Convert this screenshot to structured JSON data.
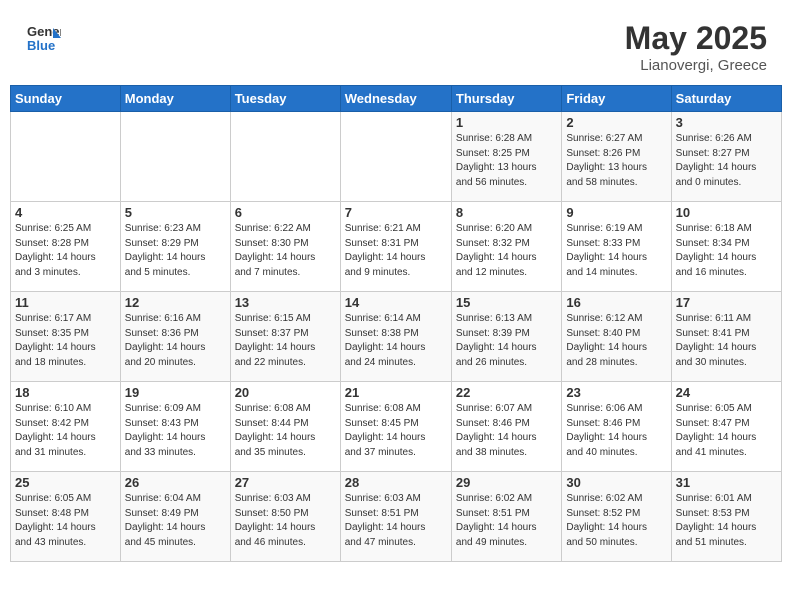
{
  "header": {
    "logo_line1": "General",
    "logo_line2": "Blue",
    "month_year": "May 2025",
    "location": "Lianovergi, Greece"
  },
  "weekdays": [
    "Sunday",
    "Monday",
    "Tuesday",
    "Wednesday",
    "Thursday",
    "Friday",
    "Saturday"
  ],
  "weeks": [
    [
      {
        "day": "",
        "detail": ""
      },
      {
        "day": "",
        "detail": ""
      },
      {
        "day": "",
        "detail": ""
      },
      {
        "day": "",
        "detail": ""
      },
      {
        "day": "1",
        "detail": "Sunrise: 6:28 AM\nSunset: 8:25 PM\nDaylight: 13 hours\nand 56 minutes."
      },
      {
        "day": "2",
        "detail": "Sunrise: 6:27 AM\nSunset: 8:26 PM\nDaylight: 13 hours\nand 58 minutes."
      },
      {
        "day": "3",
        "detail": "Sunrise: 6:26 AM\nSunset: 8:27 PM\nDaylight: 14 hours\nand 0 minutes."
      }
    ],
    [
      {
        "day": "4",
        "detail": "Sunrise: 6:25 AM\nSunset: 8:28 PM\nDaylight: 14 hours\nand 3 minutes."
      },
      {
        "day": "5",
        "detail": "Sunrise: 6:23 AM\nSunset: 8:29 PM\nDaylight: 14 hours\nand 5 minutes."
      },
      {
        "day": "6",
        "detail": "Sunrise: 6:22 AM\nSunset: 8:30 PM\nDaylight: 14 hours\nand 7 minutes."
      },
      {
        "day": "7",
        "detail": "Sunrise: 6:21 AM\nSunset: 8:31 PM\nDaylight: 14 hours\nand 9 minutes."
      },
      {
        "day": "8",
        "detail": "Sunrise: 6:20 AM\nSunset: 8:32 PM\nDaylight: 14 hours\nand 12 minutes."
      },
      {
        "day": "9",
        "detail": "Sunrise: 6:19 AM\nSunset: 8:33 PM\nDaylight: 14 hours\nand 14 minutes."
      },
      {
        "day": "10",
        "detail": "Sunrise: 6:18 AM\nSunset: 8:34 PM\nDaylight: 14 hours\nand 16 minutes."
      }
    ],
    [
      {
        "day": "11",
        "detail": "Sunrise: 6:17 AM\nSunset: 8:35 PM\nDaylight: 14 hours\nand 18 minutes."
      },
      {
        "day": "12",
        "detail": "Sunrise: 6:16 AM\nSunset: 8:36 PM\nDaylight: 14 hours\nand 20 minutes."
      },
      {
        "day": "13",
        "detail": "Sunrise: 6:15 AM\nSunset: 8:37 PM\nDaylight: 14 hours\nand 22 minutes."
      },
      {
        "day": "14",
        "detail": "Sunrise: 6:14 AM\nSunset: 8:38 PM\nDaylight: 14 hours\nand 24 minutes."
      },
      {
        "day": "15",
        "detail": "Sunrise: 6:13 AM\nSunset: 8:39 PM\nDaylight: 14 hours\nand 26 minutes."
      },
      {
        "day": "16",
        "detail": "Sunrise: 6:12 AM\nSunset: 8:40 PM\nDaylight: 14 hours\nand 28 minutes."
      },
      {
        "day": "17",
        "detail": "Sunrise: 6:11 AM\nSunset: 8:41 PM\nDaylight: 14 hours\nand 30 minutes."
      }
    ],
    [
      {
        "day": "18",
        "detail": "Sunrise: 6:10 AM\nSunset: 8:42 PM\nDaylight: 14 hours\nand 31 minutes."
      },
      {
        "day": "19",
        "detail": "Sunrise: 6:09 AM\nSunset: 8:43 PM\nDaylight: 14 hours\nand 33 minutes."
      },
      {
        "day": "20",
        "detail": "Sunrise: 6:08 AM\nSunset: 8:44 PM\nDaylight: 14 hours\nand 35 minutes."
      },
      {
        "day": "21",
        "detail": "Sunrise: 6:08 AM\nSunset: 8:45 PM\nDaylight: 14 hours\nand 37 minutes."
      },
      {
        "day": "22",
        "detail": "Sunrise: 6:07 AM\nSunset: 8:46 PM\nDaylight: 14 hours\nand 38 minutes."
      },
      {
        "day": "23",
        "detail": "Sunrise: 6:06 AM\nSunset: 8:46 PM\nDaylight: 14 hours\nand 40 minutes."
      },
      {
        "day": "24",
        "detail": "Sunrise: 6:05 AM\nSunset: 8:47 PM\nDaylight: 14 hours\nand 41 minutes."
      }
    ],
    [
      {
        "day": "25",
        "detail": "Sunrise: 6:05 AM\nSunset: 8:48 PM\nDaylight: 14 hours\nand 43 minutes."
      },
      {
        "day": "26",
        "detail": "Sunrise: 6:04 AM\nSunset: 8:49 PM\nDaylight: 14 hours\nand 45 minutes."
      },
      {
        "day": "27",
        "detail": "Sunrise: 6:03 AM\nSunset: 8:50 PM\nDaylight: 14 hours\nand 46 minutes."
      },
      {
        "day": "28",
        "detail": "Sunrise: 6:03 AM\nSunset: 8:51 PM\nDaylight: 14 hours\nand 47 minutes."
      },
      {
        "day": "29",
        "detail": "Sunrise: 6:02 AM\nSunset: 8:51 PM\nDaylight: 14 hours\nand 49 minutes."
      },
      {
        "day": "30",
        "detail": "Sunrise: 6:02 AM\nSunset: 8:52 PM\nDaylight: 14 hours\nand 50 minutes."
      },
      {
        "day": "31",
        "detail": "Sunrise: 6:01 AM\nSunset: 8:53 PM\nDaylight: 14 hours\nand 51 minutes."
      }
    ]
  ]
}
